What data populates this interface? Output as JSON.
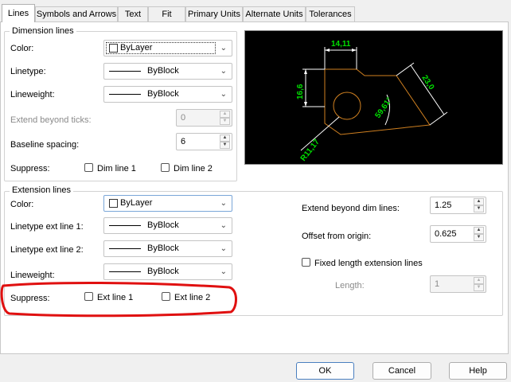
{
  "tabs": [
    "Lines",
    "Symbols and Arrows",
    "Text",
    "Fit",
    "Primary Units",
    "Alternate Units",
    "Tolerances"
  ],
  "dimension_lines": {
    "title": "Dimension lines",
    "color_label": "Color:",
    "color_value": "ByLayer",
    "linetype_label": "Linetype:",
    "linetype_value": "ByBlock",
    "lineweight_label": "Lineweight:",
    "lineweight_value": "ByBlock",
    "extend_label": "Extend beyond ticks:",
    "extend_value": "0",
    "baseline_label": "Baseline spacing:",
    "baseline_value": "6",
    "suppress_label": "Suppress:",
    "dim_line1": "Dim line 1",
    "dim_line2": "Dim line 2"
  },
  "extension_lines": {
    "title": "Extension lines",
    "color_label": "Color:",
    "color_value": "ByLayer",
    "linetype1_label": "Linetype ext line 1:",
    "linetype1_value": "ByBlock",
    "linetype2_label": "Linetype ext line 2:",
    "linetype2_value": "ByBlock",
    "lineweight_label": "Lineweight:",
    "lineweight_value": "ByBlock",
    "suppress_label": "Suppress:",
    "ext_line1": "Ext line 1",
    "ext_line2": "Ext line 2",
    "extend_beyond_label": "Extend beyond dim lines:",
    "extend_beyond_value": "1.25",
    "offset_label": "Offset from origin:",
    "offset_value": "0.625",
    "fixed_length_label": "Fixed length extension lines",
    "length_label": "Length:",
    "length_value": "1"
  },
  "preview": {
    "dim_top": "14,11",
    "dim_left": "16,6",
    "dim_right": "23,0",
    "dim_angle": "59,61°",
    "dim_radius": "R11,17"
  },
  "buttons": {
    "ok": "OK",
    "cancel": "Cancel",
    "help": "Help"
  },
  "colors": {
    "highlight": "#e01010",
    "dim_text": "#00e000",
    "geometry": "#d08020"
  }
}
